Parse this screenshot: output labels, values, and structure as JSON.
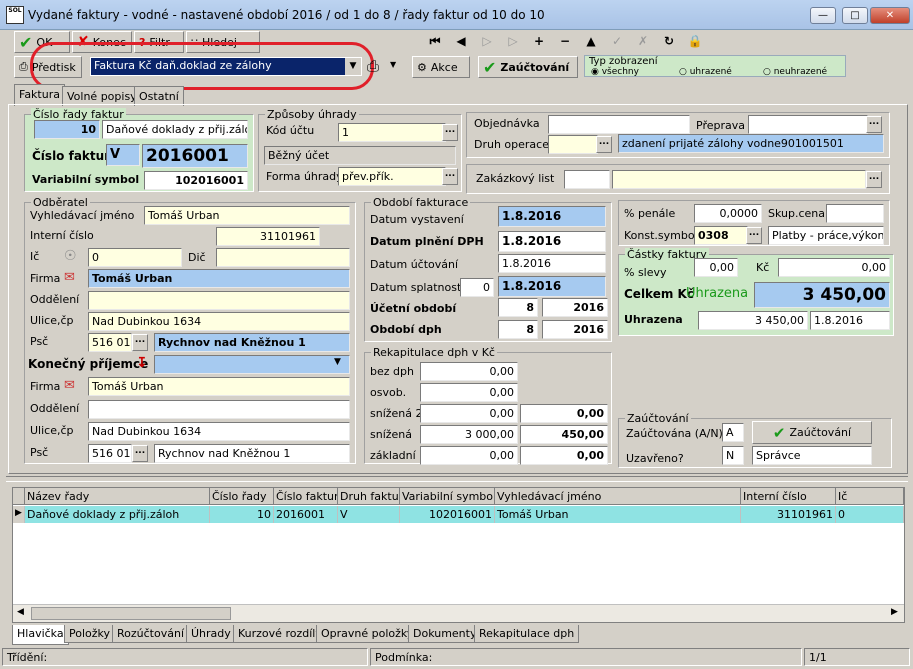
{
  "window": {
    "title": "Vydané faktury - vodné - nastavené období 2016 / od 1 do 8 / řady faktur od 10 do 10",
    "logo": "SOL"
  },
  "toolbar": {
    "ok": "OK",
    "konec": "Konec",
    "filtr": "Filtr",
    "hledej": "Hledej",
    "predtisk": "Předtisk",
    "akce": "Akce",
    "zauctovani": "Zaúčtování",
    "report_select": "Faktura Kč daň.doklad ze zálohy",
    "typ_zobrazeni": "Typ zobrazení",
    "typ_options": [
      "všechny",
      "uhrazené",
      "neuhrazené"
    ]
  },
  "tabs_top": [
    "Faktura",
    "Volné popisy",
    "Ostatní"
  ],
  "cislo_rady": {
    "title": "Číslo řady faktur",
    "rada": "10",
    "rada_name": "Daňové doklady z přij.záloh",
    "cislo_label": "Číslo faktury",
    "cislo_prefix": "V",
    "cislo": "2016001",
    "vs_label": "Variabilní symbol",
    "vs": "102016001"
  },
  "zpusoby": {
    "title": "Způsoby úhrady",
    "kod_label": "Kód účtu",
    "kod": "1",
    "ucet_name": "Běžný účet",
    "forma_label": "Forma úhrady",
    "forma": "přev.přík."
  },
  "obj": {
    "obj_label": "Objednávka",
    "obj": "",
    "preprava_label": "Přeprava",
    "preprava": "",
    "druh_label": "Druh operace",
    "druh": "",
    "druh_text": "zdanení prijaté zálohy vodne901001501",
    "zak_label": "Zakázkový list",
    "zak": "",
    "zak2": ""
  },
  "odberatel": {
    "title": "Odběratel",
    "vyhl_label": "Vyhledávací jméno",
    "vyhl": "Tomáš Urban",
    "int_label": "Interní číslo",
    "int": "31101961",
    "ic_label": "Ič",
    "ic": "0",
    "dic_label": "Dič",
    "dic": "",
    "firma_label": "Firma",
    "firma": "Tomáš Urban",
    "odd_label": "Oddělení",
    "odd": "",
    "ulice_label": "Ulice,čp",
    "ulice": "Nad Dubinkou 1634",
    "psc_label": "Psč",
    "psc": "516 01",
    "mesto": "Rychnov nad Kněžnou 1",
    "kon_label": "Konečný příjemce",
    "kon": "",
    "firma2": "Tomáš Urban",
    "odd2": "",
    "ulice2": "Nad Dubinkou 1634",
    "psc2": "516 01",
    "mesto2": "Rychnov nad Kněžnou 1"
  },
  "obdobi": {
    "title": "Období fakturace",
    "vyst_label": "Datum vystavení",
    "vyst": "1.8.2016",
    "dph_label": "Datum plnění DPH",
    "dph": "1.8.2016",
    "ucto_label": "Datum účtování",
    "ucto": "1.8.2016",
    "splat_label": "Datum splatnosti",
    "splat_days": "0",
    "splat": "1.8.2016",
    "uo_label": "Účetní období",
    "uo_m": "8",
    "uo_y": "2016",
    "od_label": "Období dph",
    "od_m": "8",
    "od_y": "2016"
  },
  "rekap": {
    "title": "Rekapitulace dph v Kč",
    "rows": [
      {
        "label": "bez dph",
        "base": "0,00",
        "tax": ""
      },
      {
        "label": "osvob.",
        "base": "0,00",
        "tax": ""
      },
      {
        "label": "snížená 2",
        "base": "0,00",
        "tax": "0,00"
      },
      {
        "label": "snížená",
        "base": "3 000,00",
        "tax": "450,00"
      },
      {
        "label": "základní",
        "base": "0,00",
        "tax": "0,00"
      }
    ]
  },
  "penale": {
    "pen_label": "% penále",
    "pen": "0,0000",
    "skup_label": "Skup.cena",
    "skup": "",
    "konst_label": "Konst.symbol",
    "konst": "0308",
    "konst_text": "Platby - práce,výkony a"
  },
  "castky": {
    "title": "Částky faktury",
    "slevy_label": "% slevy",
    "slevy": "0,00",
    "kc_label": "Kč",
    "kc": "0,00",
    "celkem_label": "Celkem Kč",
    "status": "Uhrazena",
    "celkem": "3 450,00",
    "uhr_label": "Uhrazena",
    "uhr": "3 450,00",
    "uhr_date": "1.8.2016"
  },
  "zauct": {
    "title": "Zaúčtování",
    "an_label": "Zaúčtována (A/N)",
    "an": "A",
    "btn": "Zaúčtování",
    "uz_label": "Uzavřeno?",
    "uz": "N",
    "spravce": "Správce"
  },
  "grid": {
    "headers": [
      "Název řady",
      "Číslo řady",
      "Číslo faktury",
      "Druh faktury",
      "Variabilní symbol",
      "Vyhledávací jméno",
      "Interní číslo",
      "Ič"
    ],
    "row": [
      "Daňové doklady z přij.záloh",
      "10",
      "2016001",
      "V",
      "102016001",
      "Tomáš Urban",
      "31101961",
      "0"
    ]
  },
  "tabs_bottom": [
    "Hlavička",
    "Položky",
    "Rozúčtování",
    "Úhrady",
    "Kurzové rozdíly",
    "Opravné položky",
    "Dokumenty",
    "Rekapitulace dph"
  ],
  "status": {
    "trideni": "Třídění:",
    "podminka": "Podmínka:",
    "page": "1/1"
  },
  "colors": {
    "highlight_circle": "#e0202a",
    "blue_field": "#a6caf0",
    "yellow_field": "#ffffe1",
    "grid_row": "#8fe3e3",
    "zauct_green": "#cde8c8"
  }
}
